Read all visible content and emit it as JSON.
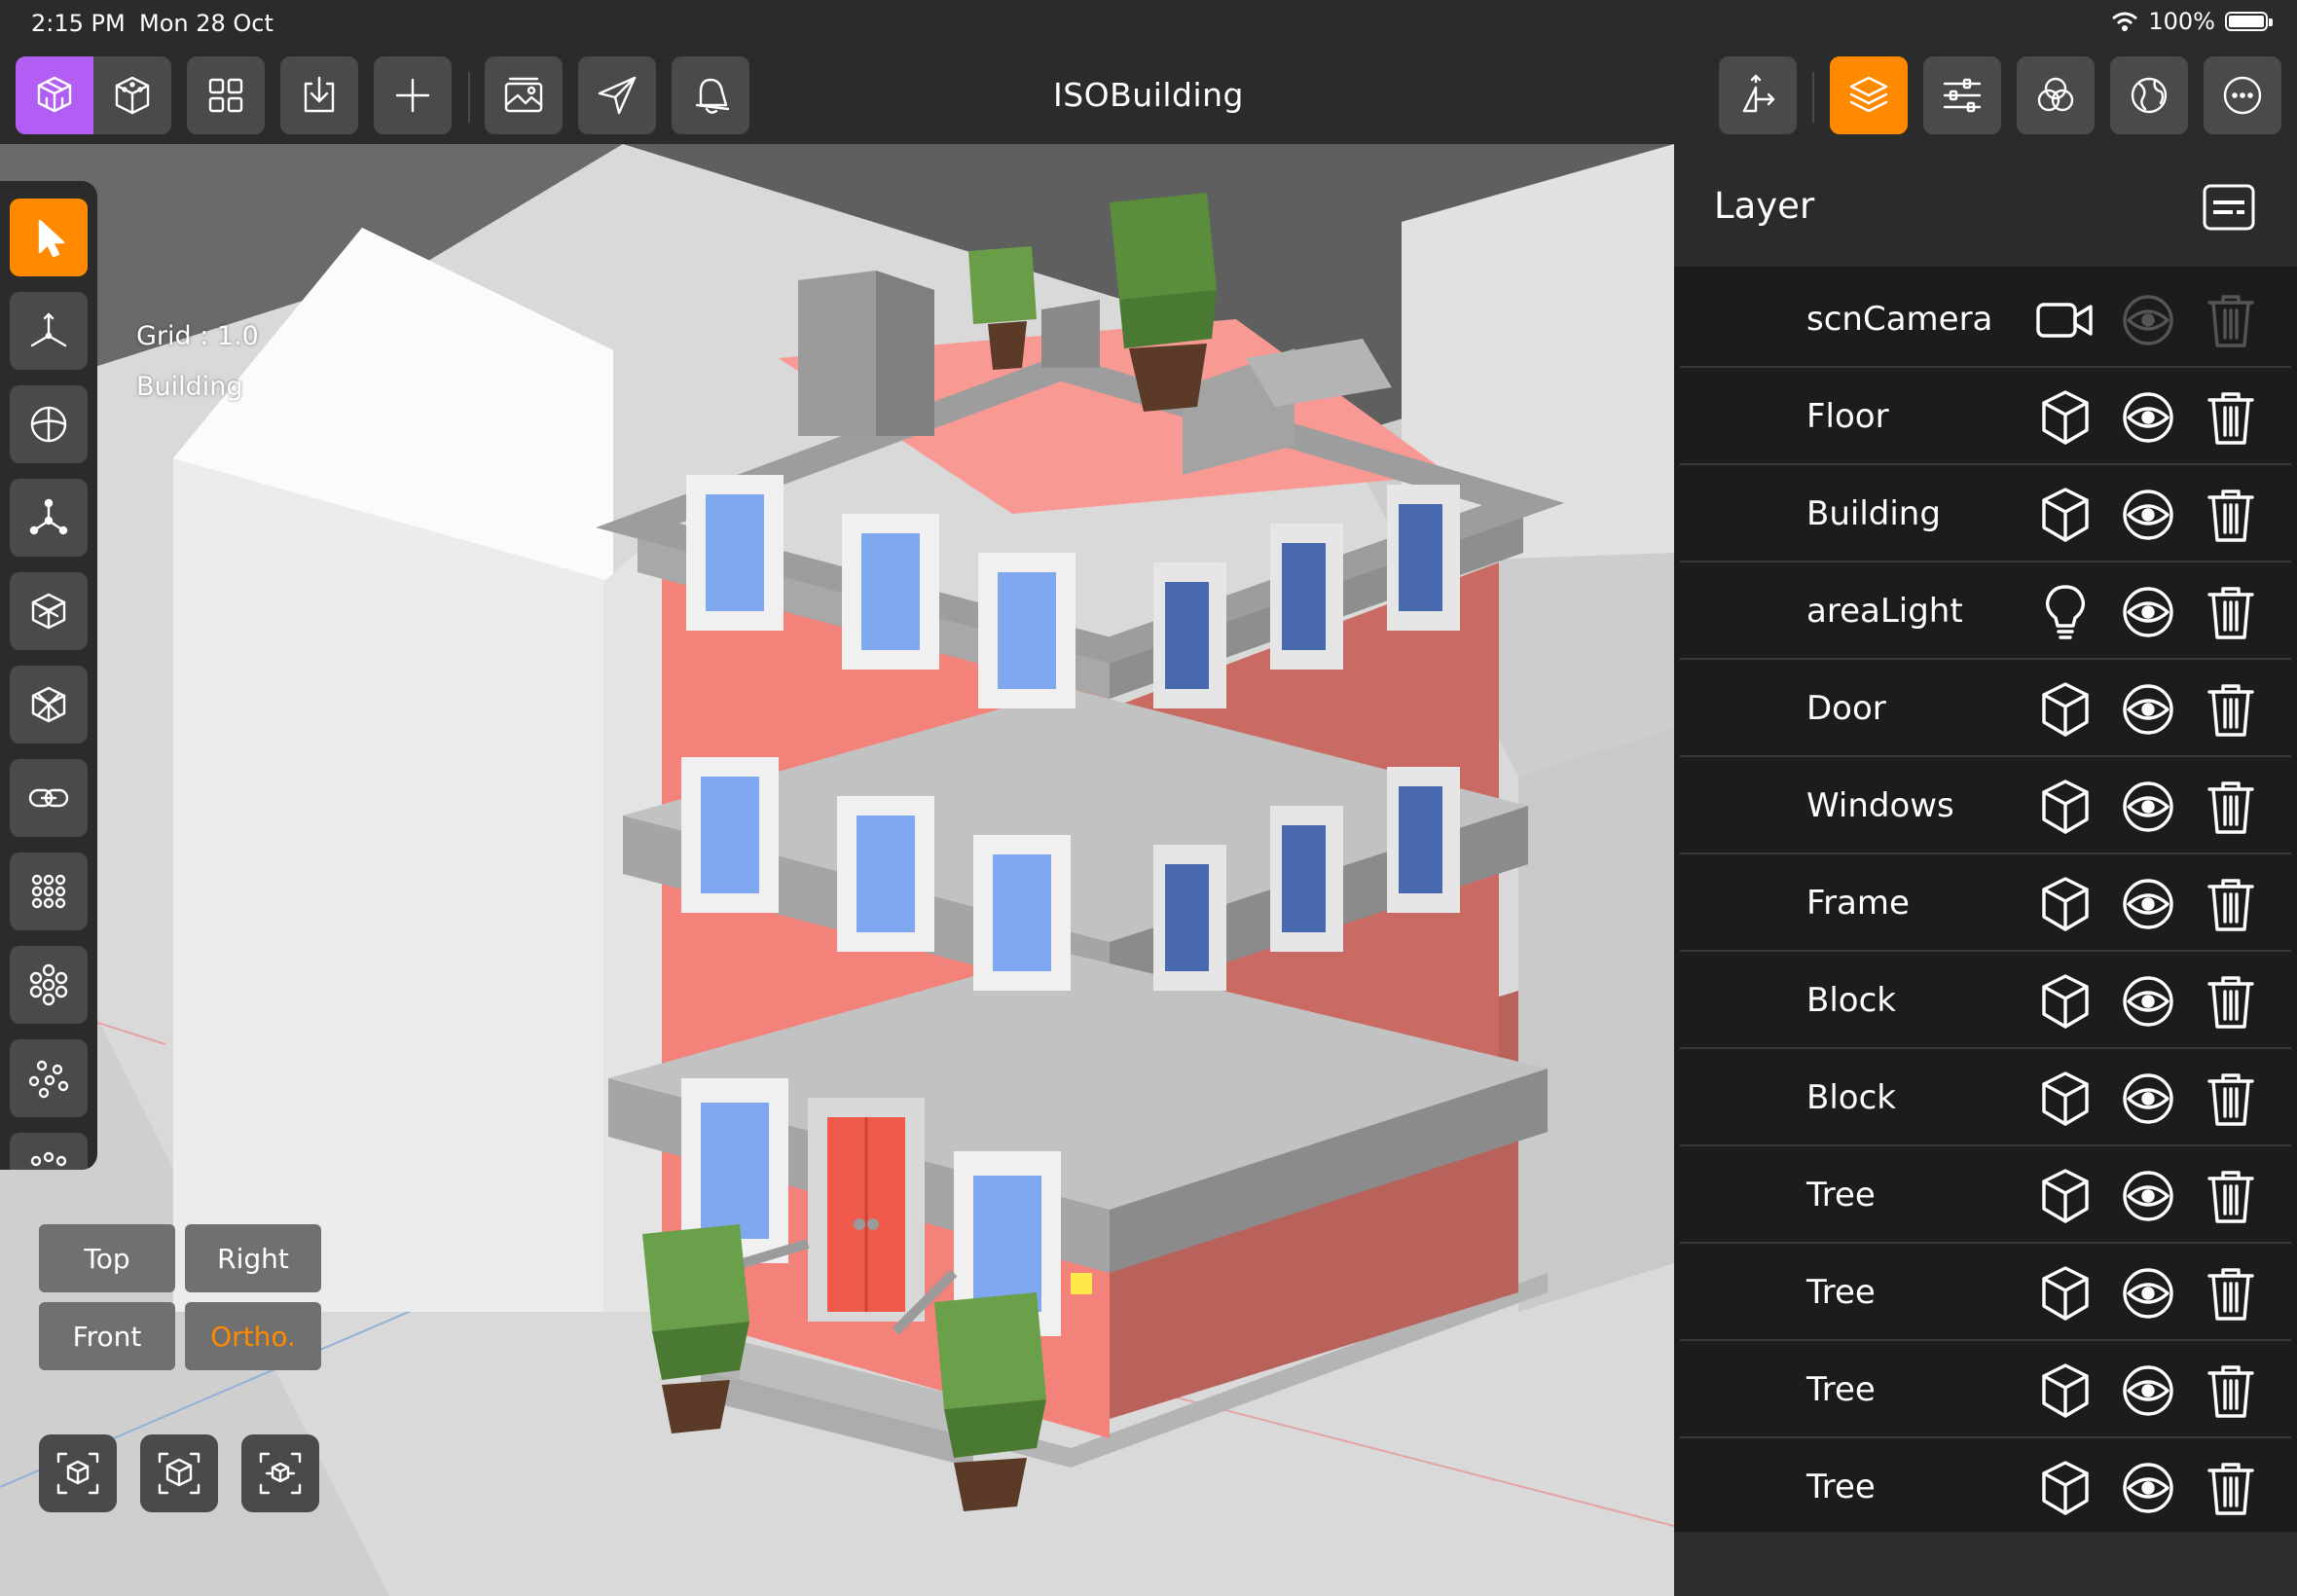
{
  "status": {
    "time": "2:15 PM",
    "date": "Mon 28 Oct",
    "battery": "100%"
  },
  "toolbar": {
    "title": "ISOBuilding",
    "left_icons": [
      "voxel-icon",
      "cube-icon",
      "grid-icon",
      "import-icon",
      "plus-icon",
      "image-icon",
      "send-icon",
      "bell-icon"
    ],
    "right_icons": [
      "move-icon",
      "layers-icon",
      "sliders-icon",
      "material-icon",
      "globe-icon",
      "more-icon"
    ],
    "active_color": "#ff8a00",
    "mode_color": "#b25df3"
  },
  "viewport": {
    "grid_label": "Grid : 1.0",
    "selection_label": "Building",
    "view_buttons": {
      "top": "Top",
      "right": "Right",
      "front": "Front",
      "ortho": "Ortho."
    }
  },
  "palette": {
    "tools": [
      "select-icon",
      "axis-icon",
      "rotate-icon",
      "pivot-icon",
      "box-frame-icon",
      "box-center-icon",
      "link-icon",
      "array-grid-icon",
      "array-circle-icon",
      "array-scatter-icon"
    ]
  },
  "layer_panel": {
    "title": "Layer",
    "rows": [
      {
        "name": "scnCamera",
        "type": "camera",
        "visible_dimmed": true
      },
      {
        "name": "Floor",
        "type": "cube"
      },
      {
        "name": "Building",
        "type": "cube"
      },
      {
        "name": "areaLight",
        "type": "light"
      },
      {
        "name": "Door",
        "type": "cube"
      },
      {
        "name": "Windows",
        "type": "cube"
      },
      {
        "name": "Frame",
        "type": "cube"
      },
      {
        "name": "Block",
        "type": "cube"
      },
      {
        "name": "Block",
        "type": "cube"
      },
      {
        "name": "Tree",
        "type": "cube"
      },
      {
        "name": "Tree",
        "type": "cube"
      },
      {
        "name": "Tree",
        "type": "cube"
      },
      {
        "name": "Tree",
        "type": "cube"
      }
    ]
  }
}
